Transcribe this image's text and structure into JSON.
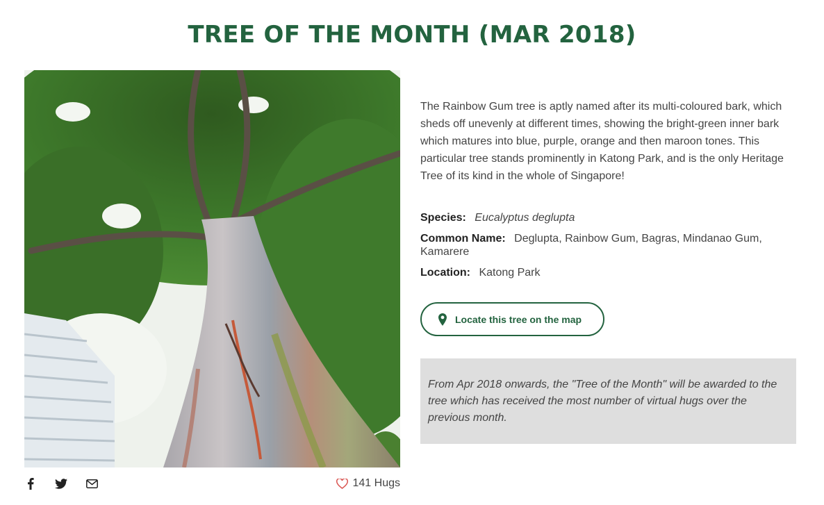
{
  "page_title": "TREE OF THE MONTH (MAR 2018)",
  "photo": {
    "alt_subject": "Rainbow Gum tree trunk viewed from below",
    "icon": "tree-photo"
  },
  "share": {
    "icons": [
      "facebook-icon",
      "twitter-icon",
      "email-icon"
    ]
  },
  "hugs": {
    "icon": "heart-outline-icon",
    "label": "141 Hugs"
  },
  "description": "The Rainbow Gum tree is aptly named after its multi-coloured bark, which sheds off unevenly at different times, showing the bright-green inner bark which matures into blue, purple, orange and then maroon tones. This particular tree stands prominently in Katong Park, and is the only Heritage Tree of its kind in the whole of Singapore!",
  "facts": {
    "species_label": "Species:",
    "species_value": "Eucalyptus deglupta",
    "common_name_label": "Common Name:",
    "common_name_value": "Deglupta, Rainbow Gum, Bagras, Mindanao Gum, Kamarere",
    "location_label": "Location:",
    "location_value": "Katong Park"
  },
  "map_button": {
    "icon": "map-pin-icon",
    "label": "Locate this tree on the map"
  },
  "notice": "From Apr 2018 onwards, the \"Tree of the Month\" will be awarded to the tree which has received the most number of virtual hugs over the previous month.",
  "colors": {
    "brand_green": "#23633f",
    "notice_bg": "#dedede",
    "heart": "#d9534f"
  }
}
